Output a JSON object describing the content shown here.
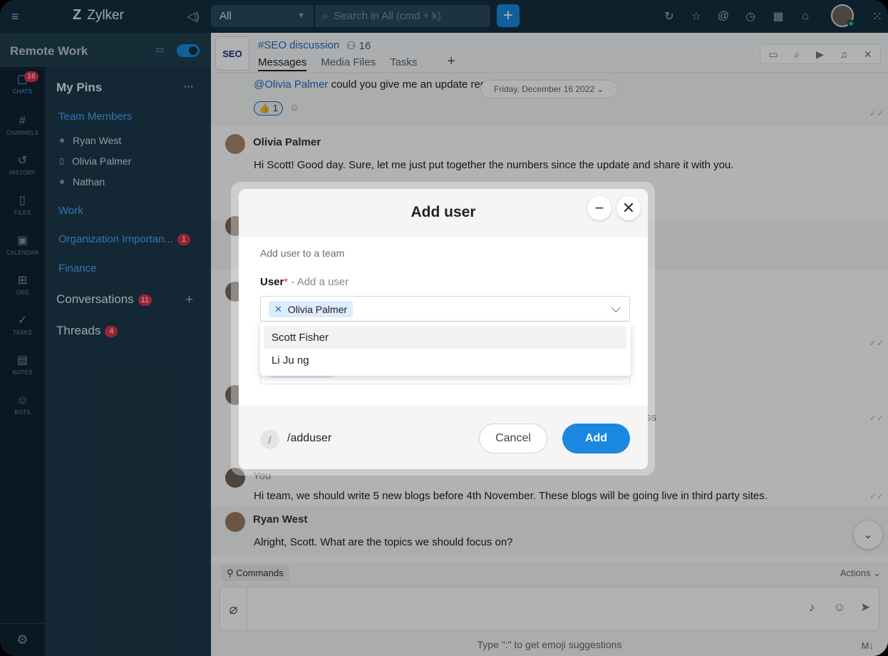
{
  "topbar": {
    "brand": "Zylker",
    "scope": "All",
    "search_placeholder": "Search in All (cmd + k)"
  },
  "rail": [
    {
      "label": "CHATS",
      "icon": "chat-icon",
      "glyph": "▢",
      "badge": "16"
    },
    {
      "label": "CHANNELS",
      "icon": "hash-icon",
      "glyph": "#"
    },
    {
      "label": "HISTORY",
      "icon": "history-icon",
      "glyph": "↺"
    },
    {
      "label": "FILES",
      "icon": "file-icon",
      "glyph": "▯"
    },
    {
      "label": "CALENDAR",
      "icon": "calendar-icon",
      "glyph": "▣"
    },
    {
      "label": "ORG",
      "icon": "org-icon",
      "glyph": "⊞"
    },
    {
      "label": "TASKS",
      "icon": "tasks-icon",
      "glyph": "✓"
    },
    {
      "label": "NOTES",
      "icon": "notes-icon",
      "glyph": "▤"
    },
    {
      "label": "BOTS",
      "icon": "bot-icon",
      "glyph": "☺"
    }
  ],
  "sidebar": {
    "workspace": "Remote Work",
    "my_pins": "My Pins",
    "pins_more": "···",
    "team_members": "Team Members",
    "users": [
      "Ryan West",
      "Olivia Palmer",
      "Nathan"
    ],
    "work": "Work",
    "org_importance": "Organization Importan...",
    "org_badge": "1",
    "finance": "Finance",
    "conversations": "Conversations",
    "conversations_badge": "11",
    "threads": "Threads",
    "threads_badge": "4"
  },
  "channel": {
    "name": "#SEO discussion",
    "members": "16",
    "logo_text": "SEO",
    "tabs": [
      "Messages",
      "Media Files",
      "Tasks"
    ]
  },
  "messages": {
    "first_mention": "@Olivia Palmer",
    "first_text": " could you give me an update rega",
    "date_pill": "Friday, December 16 2022 ⌄",
    "reaction_count": "1",
    "m2_name": "Olivia Palmer",
    "m2_text": "Hi Scott! Good day. Sure, let me just put together the numbers since the update and share it with you.",
    "partial_ss": "ss",
    "m3_name": "You",
    "m3_text": "Hi team, we should write 5 new blogs before 4th November. These blogs will be going live in third party sites.",
    "m4_name": "Ryan West",
    "m4_text": "Alright, Scott. What are the topics we should focus on?"
  },
  "composer": {
    "commands": "Commands",
    "actions": "Actions",
    "hint": "Type \":\" to get emoji suggestions",
    "md": "M↓"
  },
  "modal": {
    "title": "Add user",
    "subtitle": "Add user to a team",
    "user_label": "User",
    "required": "*",
    "user_placeholder": "- Add a user",
    "selected_chip": "Olivia Palmer",
    "options": [
      "Scott Fisher",
      "Li Ju ng"
    ],
    "command": "/adduser",
    "cancel": "Cancel",
    "add": "Add"
  },
  "colors": {
    "accent": "#1a88e0",
    "sidebar": "#1c3a4b",
    "badge": "#e0324a"
  }
}
